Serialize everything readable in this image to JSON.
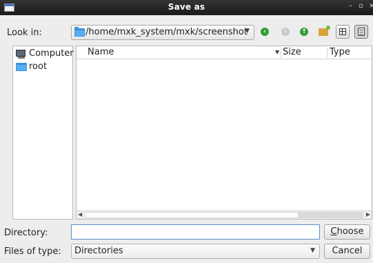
{
  "window": {
    "title": "Save as",
    "controls": {
      "minimize": "–",
      "maximize": "▫",
      "close": "×"
    }
  },
  "look_in": {
    "label": "Look in:",
    "path": "/home/mxk_system/mxk/screenshot"
  },
  "toolbar": {
    "back": "‹",
    "forward": "›",
    "parent": "↑"
  },
  "sidebar": {
    "items": [
      {
        "label": "Computer",
        "icon": "computer-icon"
      },
      {
        "label": "root",
        "icon": "folder-icon"
      }
    ]
  },
  "file_list": {
    "columns": [
      "Name",
      "Size",
      "Type"
    ],
    "rows": []
  },
  "directory": {
    "label": "Directory:",
    "value": ""
  },
  "files_of_type": {
    "label": "Files of type:",
    "value": "Directories"
  },
  "buttons": {
    "choose_first": "C",
    "choose_rest": "hoose",
    "cancel": "Cancel"
  }
}
